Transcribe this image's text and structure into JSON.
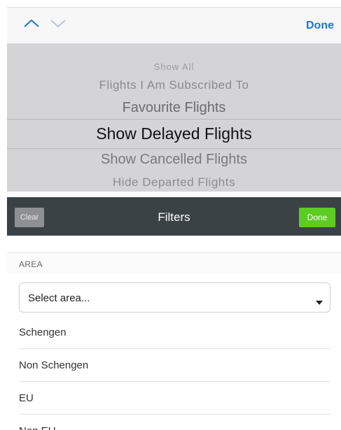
{
  "toolbar": {
    "done_label": "Done",
    "accent_color": "#1e74d4"
  },
  "picker": {
    "items": [
      "Show All",
      "Flights I Am Subscribed To",
      "Favourite Flights",
      "Show Delayed Flights",
      "Show Cancelled Flights",
      "Hide Departed Flights"
    ],
    "selected": "Show Delayed Flights"
  },
  "filter_bar": {
    "clear_label": "Clear",
    "title": "Filters",
    "done_label": "Done",
    "done_color": "#5ccc22"
  },
  "area": {
    "header": "AREA",
    "select_placeholder": "Select area...",
    "options": [
      "Schengen",
      "Non Schengen",
      "EU",
      "Non EU"
    ]
  },
  "icons": [
    "chevron-up-icon",
    "chevron-down-icon",
    "caret-down-icon"
  ]
}
